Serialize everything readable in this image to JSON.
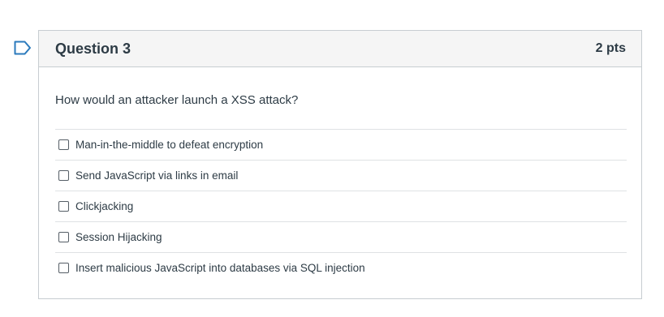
{
  "question": {
    "title": "Question 3",
    "points": "2 pts",
    "text": "How would an attacker launch a XSS attack?",
    "answers": [
      {
        "label": "Man-in-the-middle to defeat encryption",
        "checked": false
      },
      {
        "label": "Send JavaScript via links in email",
        "checked": false
      },
      {
        "label": "Clickjacking",
        "checked": false
      },
      {
        "label": "Session Hijacking",
        "checked": false
      },
      {
        "label": "Insert malicious JavaScript into databases via SQL injection",
        "checked": false
      }
    ]
  },
  "icons": {
    "flag": "flag-outline-icon"
  },
  "colors": {
    "flag_outline": "#2b7abc",
    "header_bg": "#f5f5f5",
    "border": "#c7cdd1",
    "text": "#2d3b45"
  }
}
